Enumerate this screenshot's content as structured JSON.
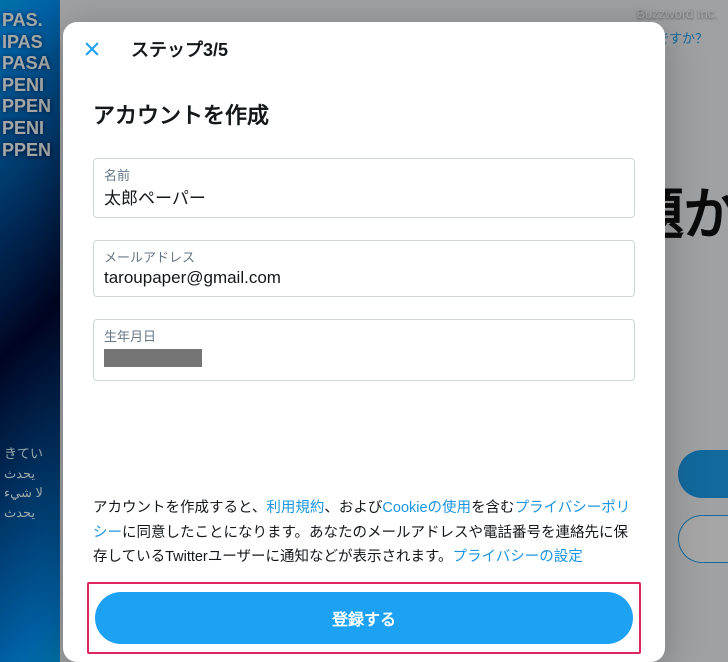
{
  "watermark": "Buzzword Inc.",
  "background": {
    "forgot_link": "パスワードをお忘れですか？",
    "headline_fragment": "題か"
  },
  "modal": {
    "step_label": "ステップ3/5",
    "title": "アカウントを作成",
    "fields": {
      "name": {
        "label": "名前",
        "value": "太郎ペーパー"
      },
      "email": {
        "label": "メールアドレス",
        "value": "taroupaper@gmail.com"
      },
      "dob": {
        "label": "生年月日",
        "value": ""
      }
    },
    "legal": {
      "t1": "アカウントを作成すると、",
      "tos": "利用規約",
      "t2": "、および",
      "cookie": "Cookieの使用",
      "t3": "を含む",
      "privacy": "プライバシーポリシー",
      "t4": "に同意したことになります。あなたのメールアドレスや電話番号を連絡先に保存しているTwitterユーザーに通知などが表示されます。",
      "privacy_settings": "プライバシーの設定"
    },
    "cta_label": "登録する"
  }
}
